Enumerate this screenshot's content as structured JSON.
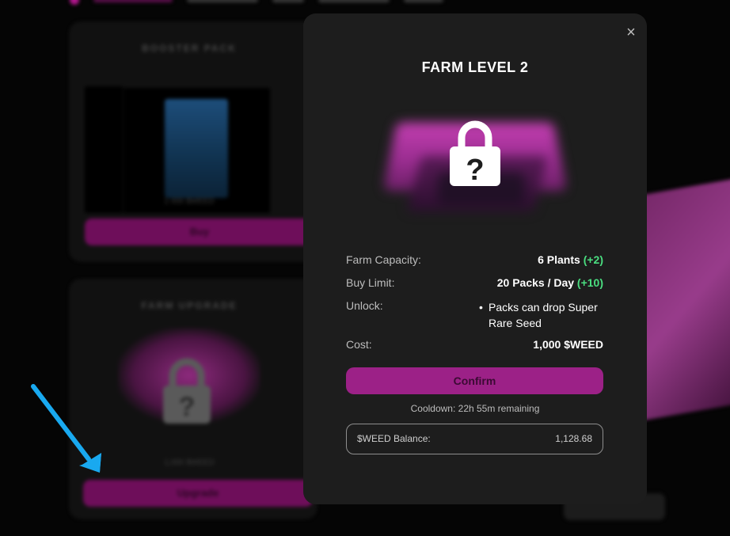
{
  "background": {
    "booster_card": {
      "title": "BOOSTER PACK",
      "price": "1 000 $WEED",
      "button_label": "Buy"
    },
    "farm_upgrade_card": {
      "title": "FARM UPGRADE",
      "price": "1,000 $WEED",
      "button_label": "Upgrade"
    }
  },
  "modal": {
    "close_glyph": "×",
    "title": "FARM LEVEL 2",
    "capacity": {
      "label": "Farm Capacity:",
      "value": "6 Plants",
      "bonus": "(+2)"
    },
    "buy_limit": {
      "label": "Buy Limit:",
      "value": "20 Packs / Day",
      "bonus": "(+10)"
    },
    "unlock": {
      "label": "Unlock:",
      "items": [
        "Packs can drop Super Rare Seed"
      ]
    },
    "cost": {
      "label": "Cost:",
      "value": "1,000 $WEED"
    },
    "confirm_label": "Confirm",
    "cooldown_text": "Cooldown: 22h 55m remaining",
    "balance": {
      "label": "$WEED Balance:",
      "value": "1,128.68"
    }
  },
  "icons": {
    "lock": "lock-question-icon",
    "arrow": "pointer-arrow-icon",
    "close": "close-icon"
  },
  "colors": {
    "accent": "#9c2187",
    "bonus_green": "#4ade80",
    "modal_bg": "#1d1d1d",
    "arrow": "#19a9f0"
  }
}
